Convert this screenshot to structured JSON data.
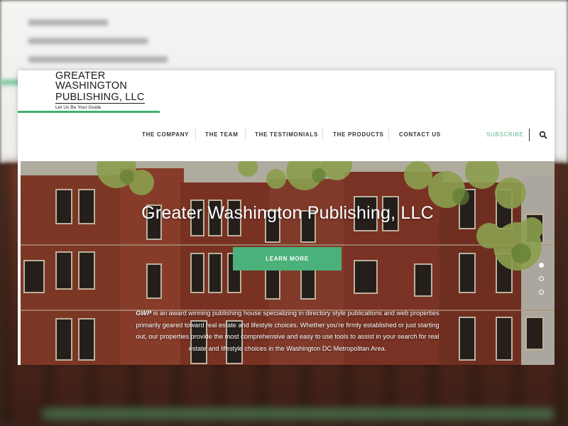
{
  "logo": {
    "line1": "GREATER",
    "line2": "WASHINGTON",
    "line3": "PUBLISHING, LLC",
    "tagline": "Let Us Be Your Guide"
  },
  "nav": {
    "items": [
      {
        "label": "THE COMPANY"
      },
      {
        "label": "THE TEAM"
      },
      {
        "label": "THE TESTIMONIALS"
      },
      {
        "label": "THE PRODUCTS"
      },
      {
        "label": "CONTACT US"
      }
    ],
    "subscribe": "SUBSCRIBE",
    "search_icon": "search-icon"
  },
  "hero": {
    "title": "Greater Washington Publishing, LLC",
    "button": "LEARN MORE",
    "abbr": "GWP",
    "description": " is an award winning publishing house specializing in directory style publications and web properties primarily geared toward real estate and lifestyle choices. Whether you're firmly established or just starting out, our properties provide the most comprehensive and easy to use tools to assist in your search for real estate and lifestyle choices in the Washington DC Metropolitan Area.",
    "slides": 3,
    "active_slide": 1
  },
  "colors": {
    "accent_green": "#4bb17a",
    "logo_underline": "#3fae72",
    "brick": "#8a3c28"
  }
}
